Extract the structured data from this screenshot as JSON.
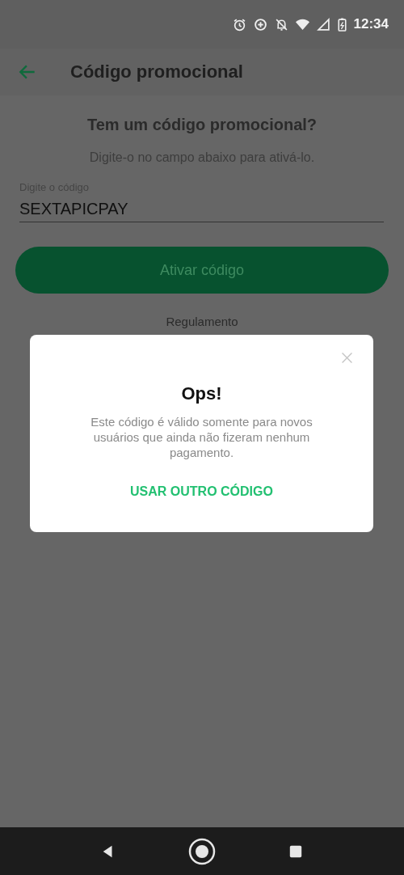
{
  "status_bar": {
    "time": "12:34"
  },
  "app_bar": {
    "title": "Código promocional"
  },
  "content": {
    "heading": "Tem um código promocional?",
    "subtitle": "Digite-o no campo abaixo para ativá-lo.",
    "field": {
      "label": "Digite o código",
      "value": "SEXTAPICPAY"
    },
    "button": "Ativar código",
    "link": "Regulamento"
  },
  "dialog": {
    "title": "Ops!",
    "message": "Este código é válido somente para novos usuários que ainda não fizeram nenhum pagamento.",
    "action": "USAR OUTRO CÓDIGO"
  }
}
